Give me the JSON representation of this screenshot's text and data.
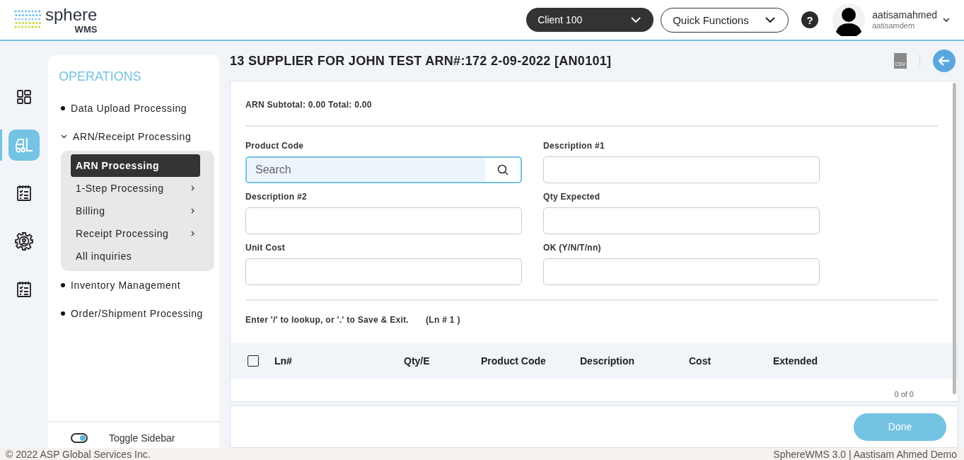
{
  "header": {
    "logo": {
      "name": "sphere",
      "sub": "WMS"
    },
    "client": "Client 100",
    "quick_functions": "Quick Functions",
    "help": "?",
    "user": {
      "name": "aatisamahmed",
      "account": "aatisamdem"
    }
  },
  "rail": [
    {
      "kind": "dashboard",
      "selected": false
    },
    {
      "kind": "forklift",
      "selected": true
    },
    {
      "kind": "checklist",
      "selected": false
    },
    {
      "kind": "gear",
      "selected": false
    },
    {
      "kind": "checklist",
      "selected": false
    }
  ],
  "sidebar": {
    "title": "OPERATIONS",
    "items": [
      {
        "label": "Data Upload Processing",
        "kind": "bullet"
      },
      {
        "label": "ARN/Receipt Processing",
        "kind": "group",
        "expanded": true,
        "children": [
          {
            "label": "ARN Processing",
            "selected": true,
            "submenu": false
          },
          {
            "label": "1-Step Processing",
            "selected": false,
            "submenu": true
          },
          {
            "label": "Billing",
            "selected": false,
            "submenu": true
          },
          {
            "label": "Receipt Processing",
            "selected": false,
            "submenu": true
          },
          {
            "label": "All inquiries",
            "selected": false,
            "submenu": false
          }
        ]
      },
      {
        "label": "Inventory Management",
        "kind": "bullet"
      },
      {
        "label": "Order/Shipment Processing",
        "kind": "bullet"
      }
    ],
    "toggle": {
      "label": "Toggle Sidebar",
      "on": true
    }
  },
  "page": {
    "title": "13 SUPPLIER FOR JOHN TEST ARN#:172 2-09-2022 [AN0101]",
    "csv": "CSV",
    "subtotal": "ARN Subtotal: 0.00 Total: 0.00",
    "fields": [
      {
        "label": "Product Code",
        "kind": "search",
        "placeholder": "Search"
      },
      {
        "label": "Description #1",
        "kind": "text"
      },
      {
        "label": "Description #2",
        "kind": "text"
      },
      {
        "label": "Qty Expected",
        "kind": "text"
      },
      {
        "label": "Unit Cost",
        "kind": "text"
      },
      {
        "label": "OK (Y/N/T/nn)",
        "kind": "text"
      }
    ],
    "hint": "Enter '/' to lookup, or '.' to Save & Exit.",
    "line": "(Ln # 1 )",
    "table": {
      "select_all": {
        "checked": false
      },
      "columns": [
        "Ln#",
        "Qty/E",
        "Product Code",
        "Description",
        "Cost",
        "Extended"
      ],
      "pager": "0 of 0"
    },
    "done": "Done"
  },
  "footer": {
    "left": "© 2022 ASP Global Services Inc.",
    "right": "SphereWMS 3.0 | Aastisam Ahmed Demo"
  }
}
